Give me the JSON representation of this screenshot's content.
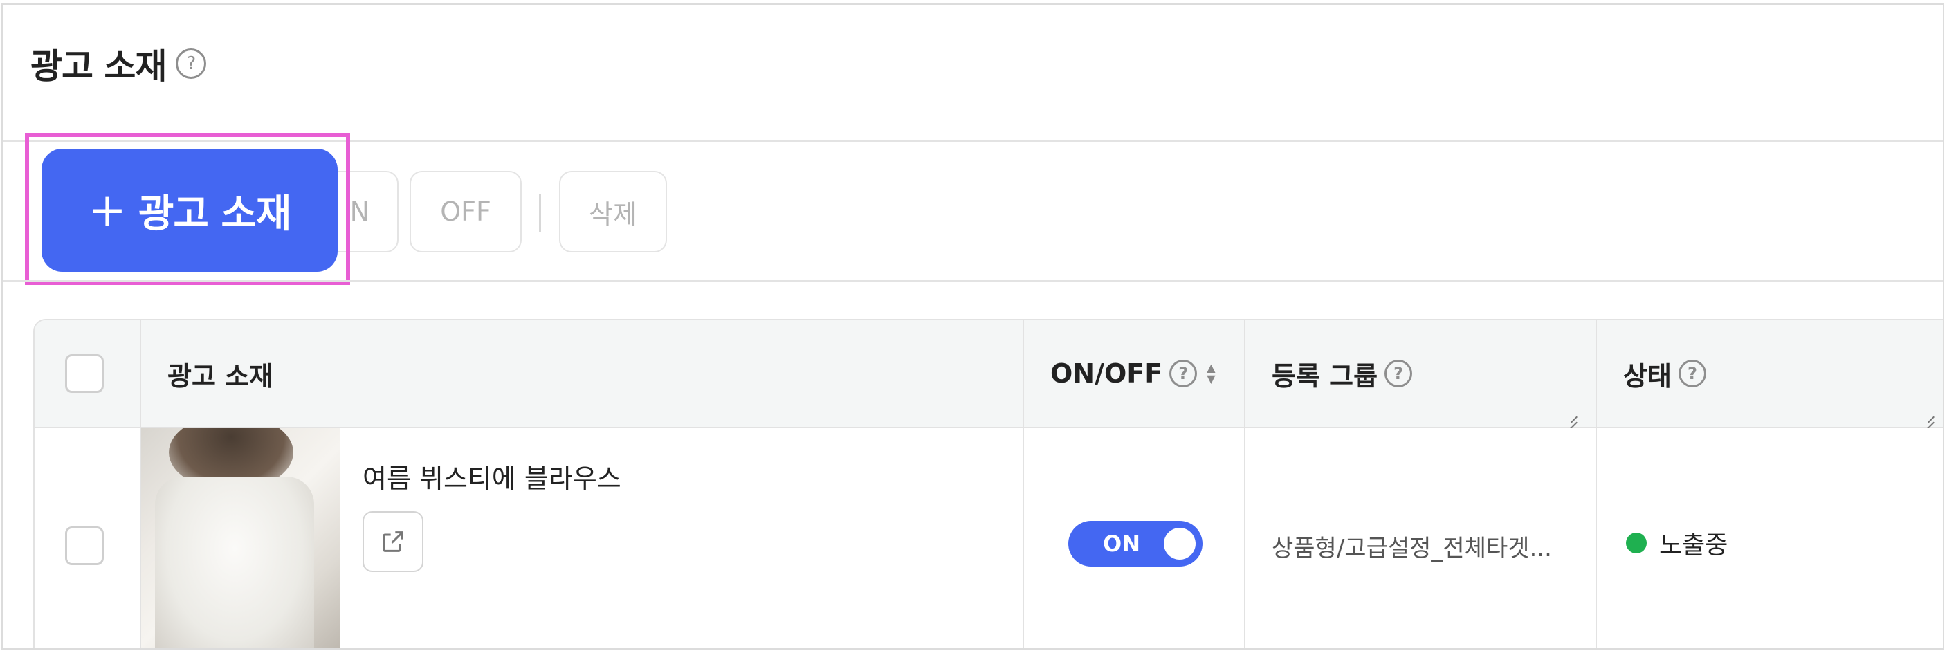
{
  "page": {
    "title": "광고 소재",
    "help_icon": "question-circle-icon"
  },
  "toolbar": {
    "add_button_label": "광고 소재",
    "add_icon": "plus-icon",
    "on_label": "N",
    "off_label": "OFF",
    "delete_label": "삭제"
  },
  "table": {
    "columns": [
      {
        "key": "select",
        "label": ""
      },
      {
        "key": "creative",
        "label": "광고 소재"
      },
      {
        "key": "onoff",
        "label": "ON/OFF"
      },
      {
        "key": "group",
        "label": "등록 그룹"
      },
      {
        "key": "status",
        "label": "상태"
      }
    ],
    "rows": [
      {
        "creative_name": "여름 뷔스티에 블라우스",
        "toggle_label": "ON",
        "group": "상품형/고급설정_전체타겟...",
        "status": "노출중",
        "status_color": "#1fb050"
      }
    ]
  },
  "colors": {
    "accent": "#4467f2",
    "highlight": "#e85ed4"
  }
}
